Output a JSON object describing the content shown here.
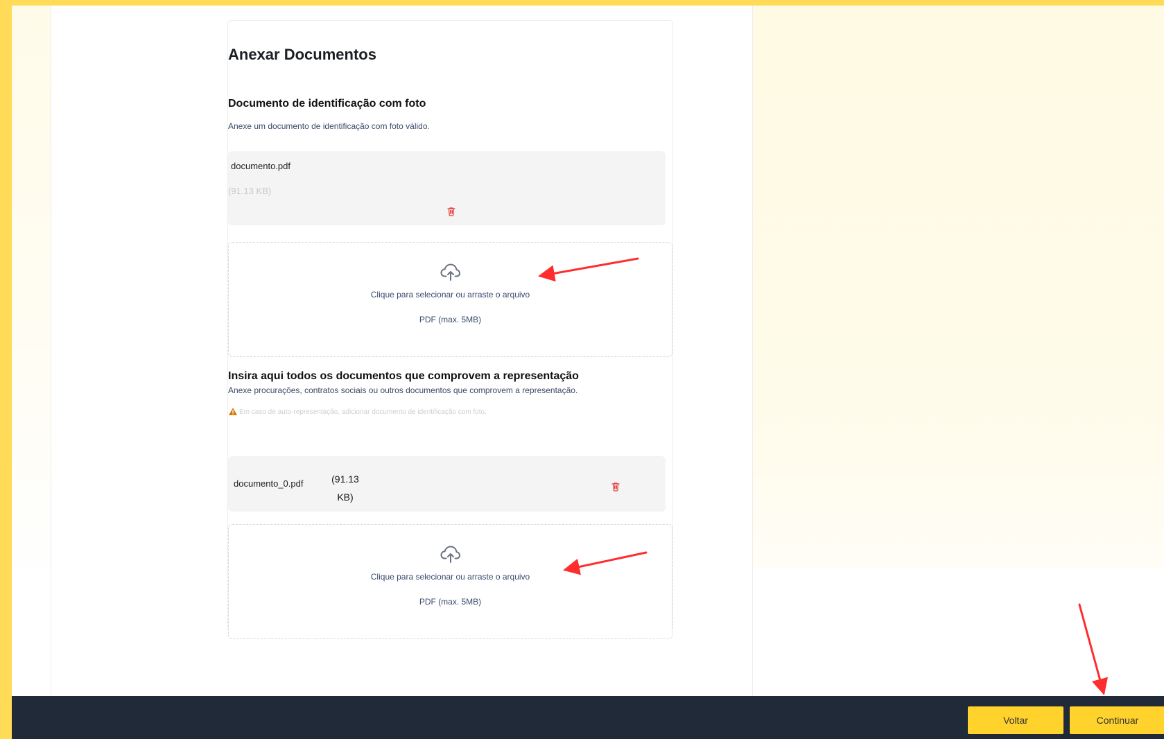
{
  "card": {
    "title": "Anexar Documentos"
  },
  "section_id": {
    "title": "Documento de identificação com foto",
    "description": "Anexe um documento de identificação com foto válido.",
    "file": {
      "name": "documento.pdf",
      "size": "(91.13 KB)"
    },
    "dropzone": {
      "primary": "Clique para selecionar ou arraste o arquivo",
      "secondary": "PDF (max. 5MB)"
    }
  },
  "section_representation": {
    "title": "Insira aqui todos os documentos que comprovem a representação",
    "description": "Anexe procurações, contratos sociais ou outros documentos que comprovem a representação.",
    "warning": "Em caso de auto-representação, adicionar documento de identificação com foto.",
    "file": {
      "name": "documento_0.pdf",
      "size": "(91.13 KB)"
    },
    "dropzone": {
      "primary": "Clique para selecionar ou arraste o arquivo",
      "secondary": "PDF (max. 5MB)"
    }
  },
  "footer": {
    "back_label": "Voltar",
    "next_label": "Continuar"
  },
  "icons": {
    "trash": "trash-icon",
    "upload": "cloud-upload-icon",
    "warning": "warning-icon"
  },
  "colors": {
    "page_accent": "#ffdb57",
    "button_yellow": "#ffd22c",
    "footer_navy": "#202a39",
    "danger_red": "#e53935",
    "annotation_red": "#ff2d2d",
    "link_blue": "#384b6d"
  }
}
